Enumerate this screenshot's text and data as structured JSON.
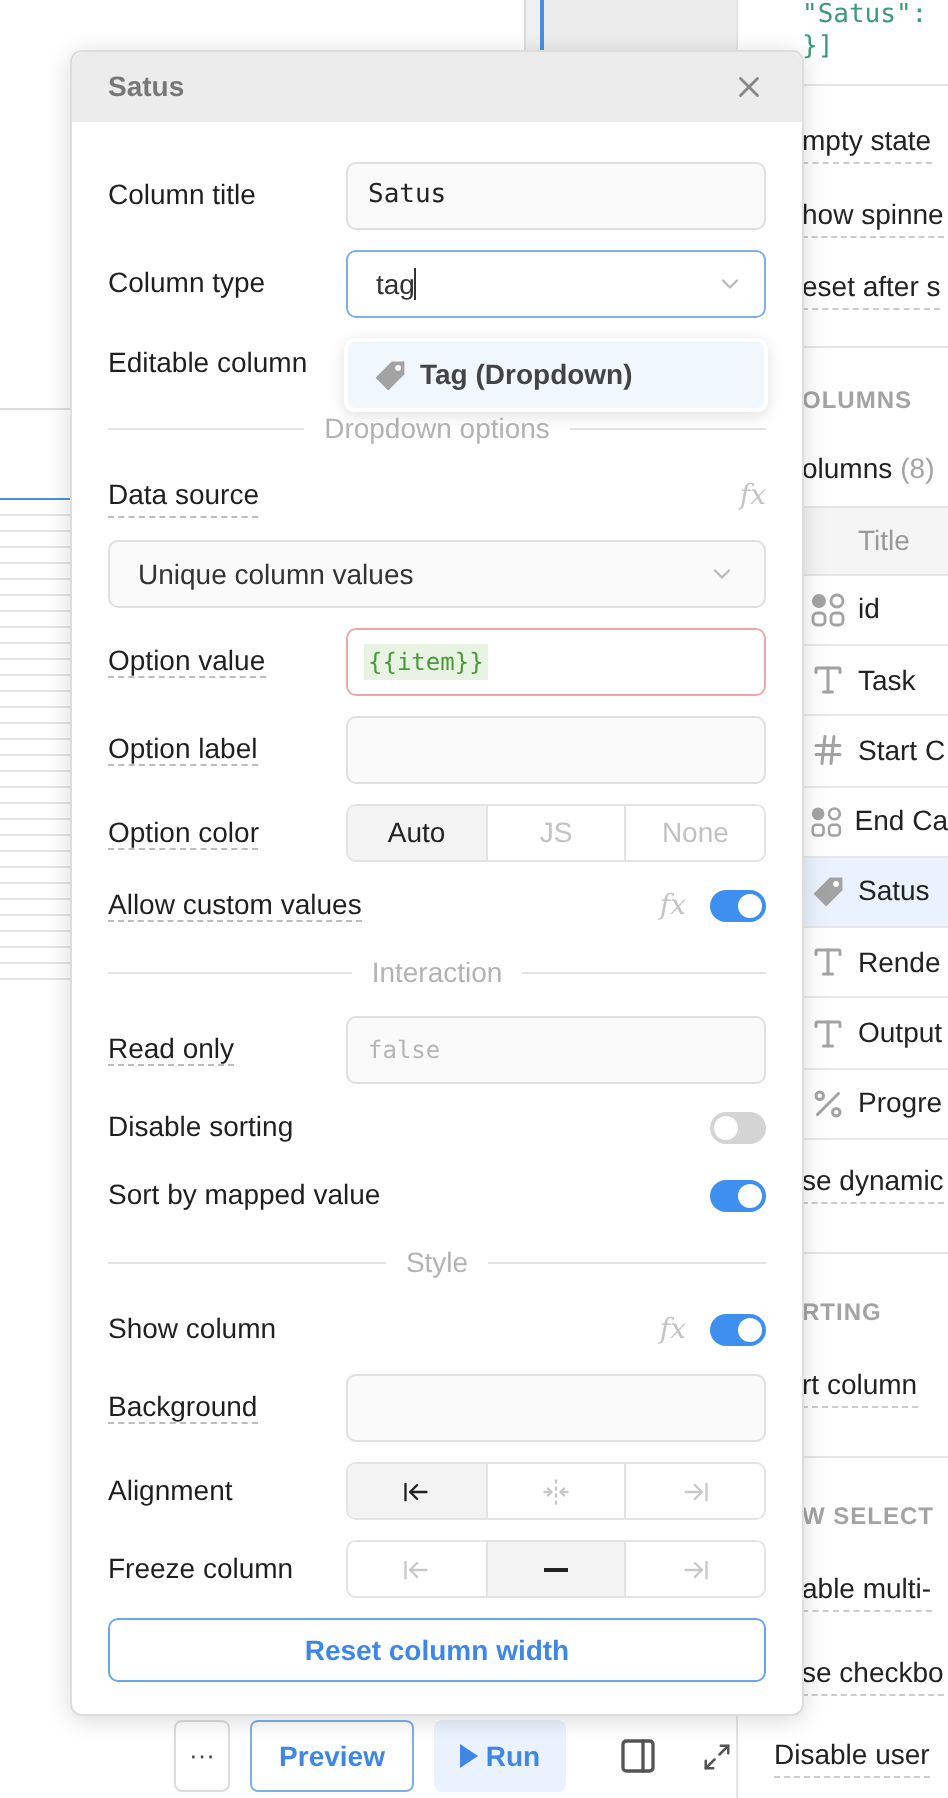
{
  "dialog": {
    "title": "Satus",
    "rows": [
      {
        "kind": "input",
        "label": "Column title",
        "underlined": false,
        "value": "Satus"
      },
      {
        "kind": "combo",
        "label": "Column type",
        "underlined": false,
        "value": "tag",
        "focused": true
      },
      {
        "kind": "label",
        "label": "Editable column",
        "underlined": false
      },
      {
        "kind": "divider",
        "label": "Dropdown options"
      },
      {
        "kind": "label",
        "label": "Data source",
        "underlined": true,
        "fx": "fx"
      },
      {
        "kind": "select",
        "value": "Unique column values"
      },
      {
        "kind": "code",
        "label": "Option value",
        "underlined": true,
        "value": "{{item}}",
        "error": true
      },
      {
        "kind": "input",
        "label": "Option label",
        "underlined": true
      },
      {
        "kind": "segmented",
        "label": "Option color",
        "underlined": true,
        "options": [
          {
            "label": "Auto",
            "selected": true
          },
          {
            "label": "JS",
            "selected": false
          },
          {
            "label": "None",
            "selected": false
          }
        ]
      },
      {
        "kind": "toggle",
        "label": "Allow custom values",
        "underlined": true,
        "fx": "fx",
        "on": true
      },
      {
        "kind": "divider",
        "label": "Interaction"
      },
      {
        "kind": "code",
        "label": "Read only",
        "underlined": true,
        "placeholder": "false",
        "error": false
      },
      {
        "kind": "toggle",
        "label": "Disable sorting",
        "underlined": false,
        "on": false
      },
      {
        "kind": "toggle",
        "label": "Sort by mapped value",
        "underlined": false,
        "on": true
      },
      {
        "kind": "divider",
        "label": "Style"
      },
      {
        "kind": "toggle",
        "label": "Show column",
        "underlined": false,
        "fx": "fx",
        "on": true
      },
      {
        "kind": "input",
        "label": "Background",
        "underlined": true
      },
      {
        "kind": "align",
        "label": "Alignment",
        "underlined": false,
        "options": [
          {
            "selected": true
          },
          {
            "selected": false
          },
          {
            "selected": false
          }
        ]
      },
      {
        "kind": "freeze",
        "label": "Freeze column",
        "underlined": false,
        "options": [
          {
            "selected": false
          },
          {
            "selected": true
          },
          {
            "selected": false
          }
        ]
      },
      {
        "kind": "button",
        "label": "Reset column width"
      }
    ],
    "menu": {
      "items": [
        {
          "label": "Tag (Dropdown)",
          "selected": true
        }
      ]
    }
  },
  "right_panel": {
    "items": [
      {
        "kind": "code",
        "text": "\"Satus\":"
      },
      {
        "kind": "code",
        "text": "}]"
      },
      {
        "kind": "rule"
      },
      {
        "kind": "setting",
        "text": "mpty state"
      },
      {
        "kind": "setting",
        "text": "how spinne"
      },
      {
        "kind": "setting",
        "text": "eset after s"
      },
      {
        "kind": "rule"
      },
      {
        "kind": "section",
        "text": "OLUMNS"
      },
      {
        "kind": "count",
        "text": "olumns",
        "count": "(8)"
      },
      {
        "kind": "header",
        "text": "Title"
      },
      {
        "kind": "grid-column",
        "text": "id",
        "selected": false
      },
      {
        "kind": "text-column",
        "text": "Task",
        "selected": false
      },
      {
        "kind": "number-column",
        "text": "Start C",
        "selected": false
      },
      {
        "kind": "grid-column",
        "text": "End Ca",
        "selected": false
      },
      {
        "kind": "tag-column",
        "text": "Satus",
        "selected": true
      },
      {
        "kind": "text-column",
        "text": "Rende",
        "selected": false
      },
      {
        "kind": "text-column",
        "text": "Output",
        "selected": false
      },
      {
        "kind": "percent-column",
        "text": "Progre",
        "selected": false
      },
      {
        "kind": "setting",
        "text": "se dynamic"
      },
      {
        "kind": "rule"
      },
      {
        "kind": "section",
        "text": "RTING"
      },
      {
        "kind": "setting",
        "text": "rt column"
      },
      {
        "kind": "rule"
      },
      {
        "kind": "section",
        "text": "W SELECT"
      },
      {
        "kind": "setting",
        "text": "able multi-"
      },
      {
        "kind": "setting",
        "text": "se checkbo"
      },
      {
        "kind": "outer-setting",
        "text": "Disable user"
      }
    ]
  },
  "toolbar": {
    "more": "···",
    "preview": "Preview",
    "run": "Run"
  }
}
